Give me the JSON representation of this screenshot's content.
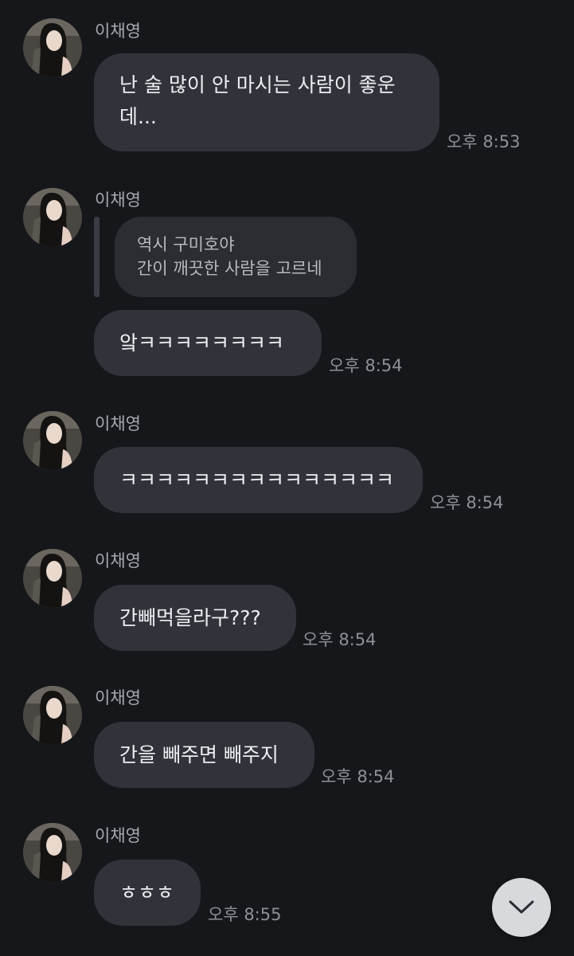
{
  "chat": {
    "groups": [
      {
        "sender": "이채영",
        "messages": [
          {
            "text": "난 술 많이 안 마시는 사람이 좋운\n데...",
            "time": "오후 8:53"
          }
        ]
      },
      {
        "sender": "이채영",
        "reply": {
          "lines": [
            "역시 구미호야",
            "간이 깨끗한 사람을 고르네"
          ]
        },
        "messages": [
          {
            "text": "앜ㅋㅋㅋㅋㅋㅋㅋㅋ",
            "time": "오후 8:54"
          }
        ]
      },
      {
        "sender": "이채영",
        "messages": [
          {
            "text": "ㅋㅋㅋㅋㅋㅋㅋㅋㅋㅋㅋㅋㅋㅋㅋ",
            "time": "오후 8:54"
          }
        ]
      },
      {
        "sender": "이채영",
        "messages": [
          {
            "text": "간빼먹을라구???",
            "time": "오후 8:54"
          }
        ]
      },
      {
        "sender": "이채영",
        "messages": [
          {
            "text": "간을 빼주면 빼주지",
            "time": "오후 8:54"
          }
        ]
      },
      {
        "sender": "이채영",
        "messages": [
          {
            "text": "ㅎㅎㅎ",
            "time": "오후 8:55"
          }
        ]
      }
    ]
  },
  "avatar": {
    "icon": "profile-photo"
  },
  "scroll_button": {
    "icon": "chevron-down-icon"
  },
  "colors": {
    "background": "#16171b",
    "bubble": "#31333a",
    "reply_bubble": "#2b2d33",
    "text": "#eceef2",
    "meta": "#8e9096",
    "scroll_button": "#d8d9dc"
  }
}
